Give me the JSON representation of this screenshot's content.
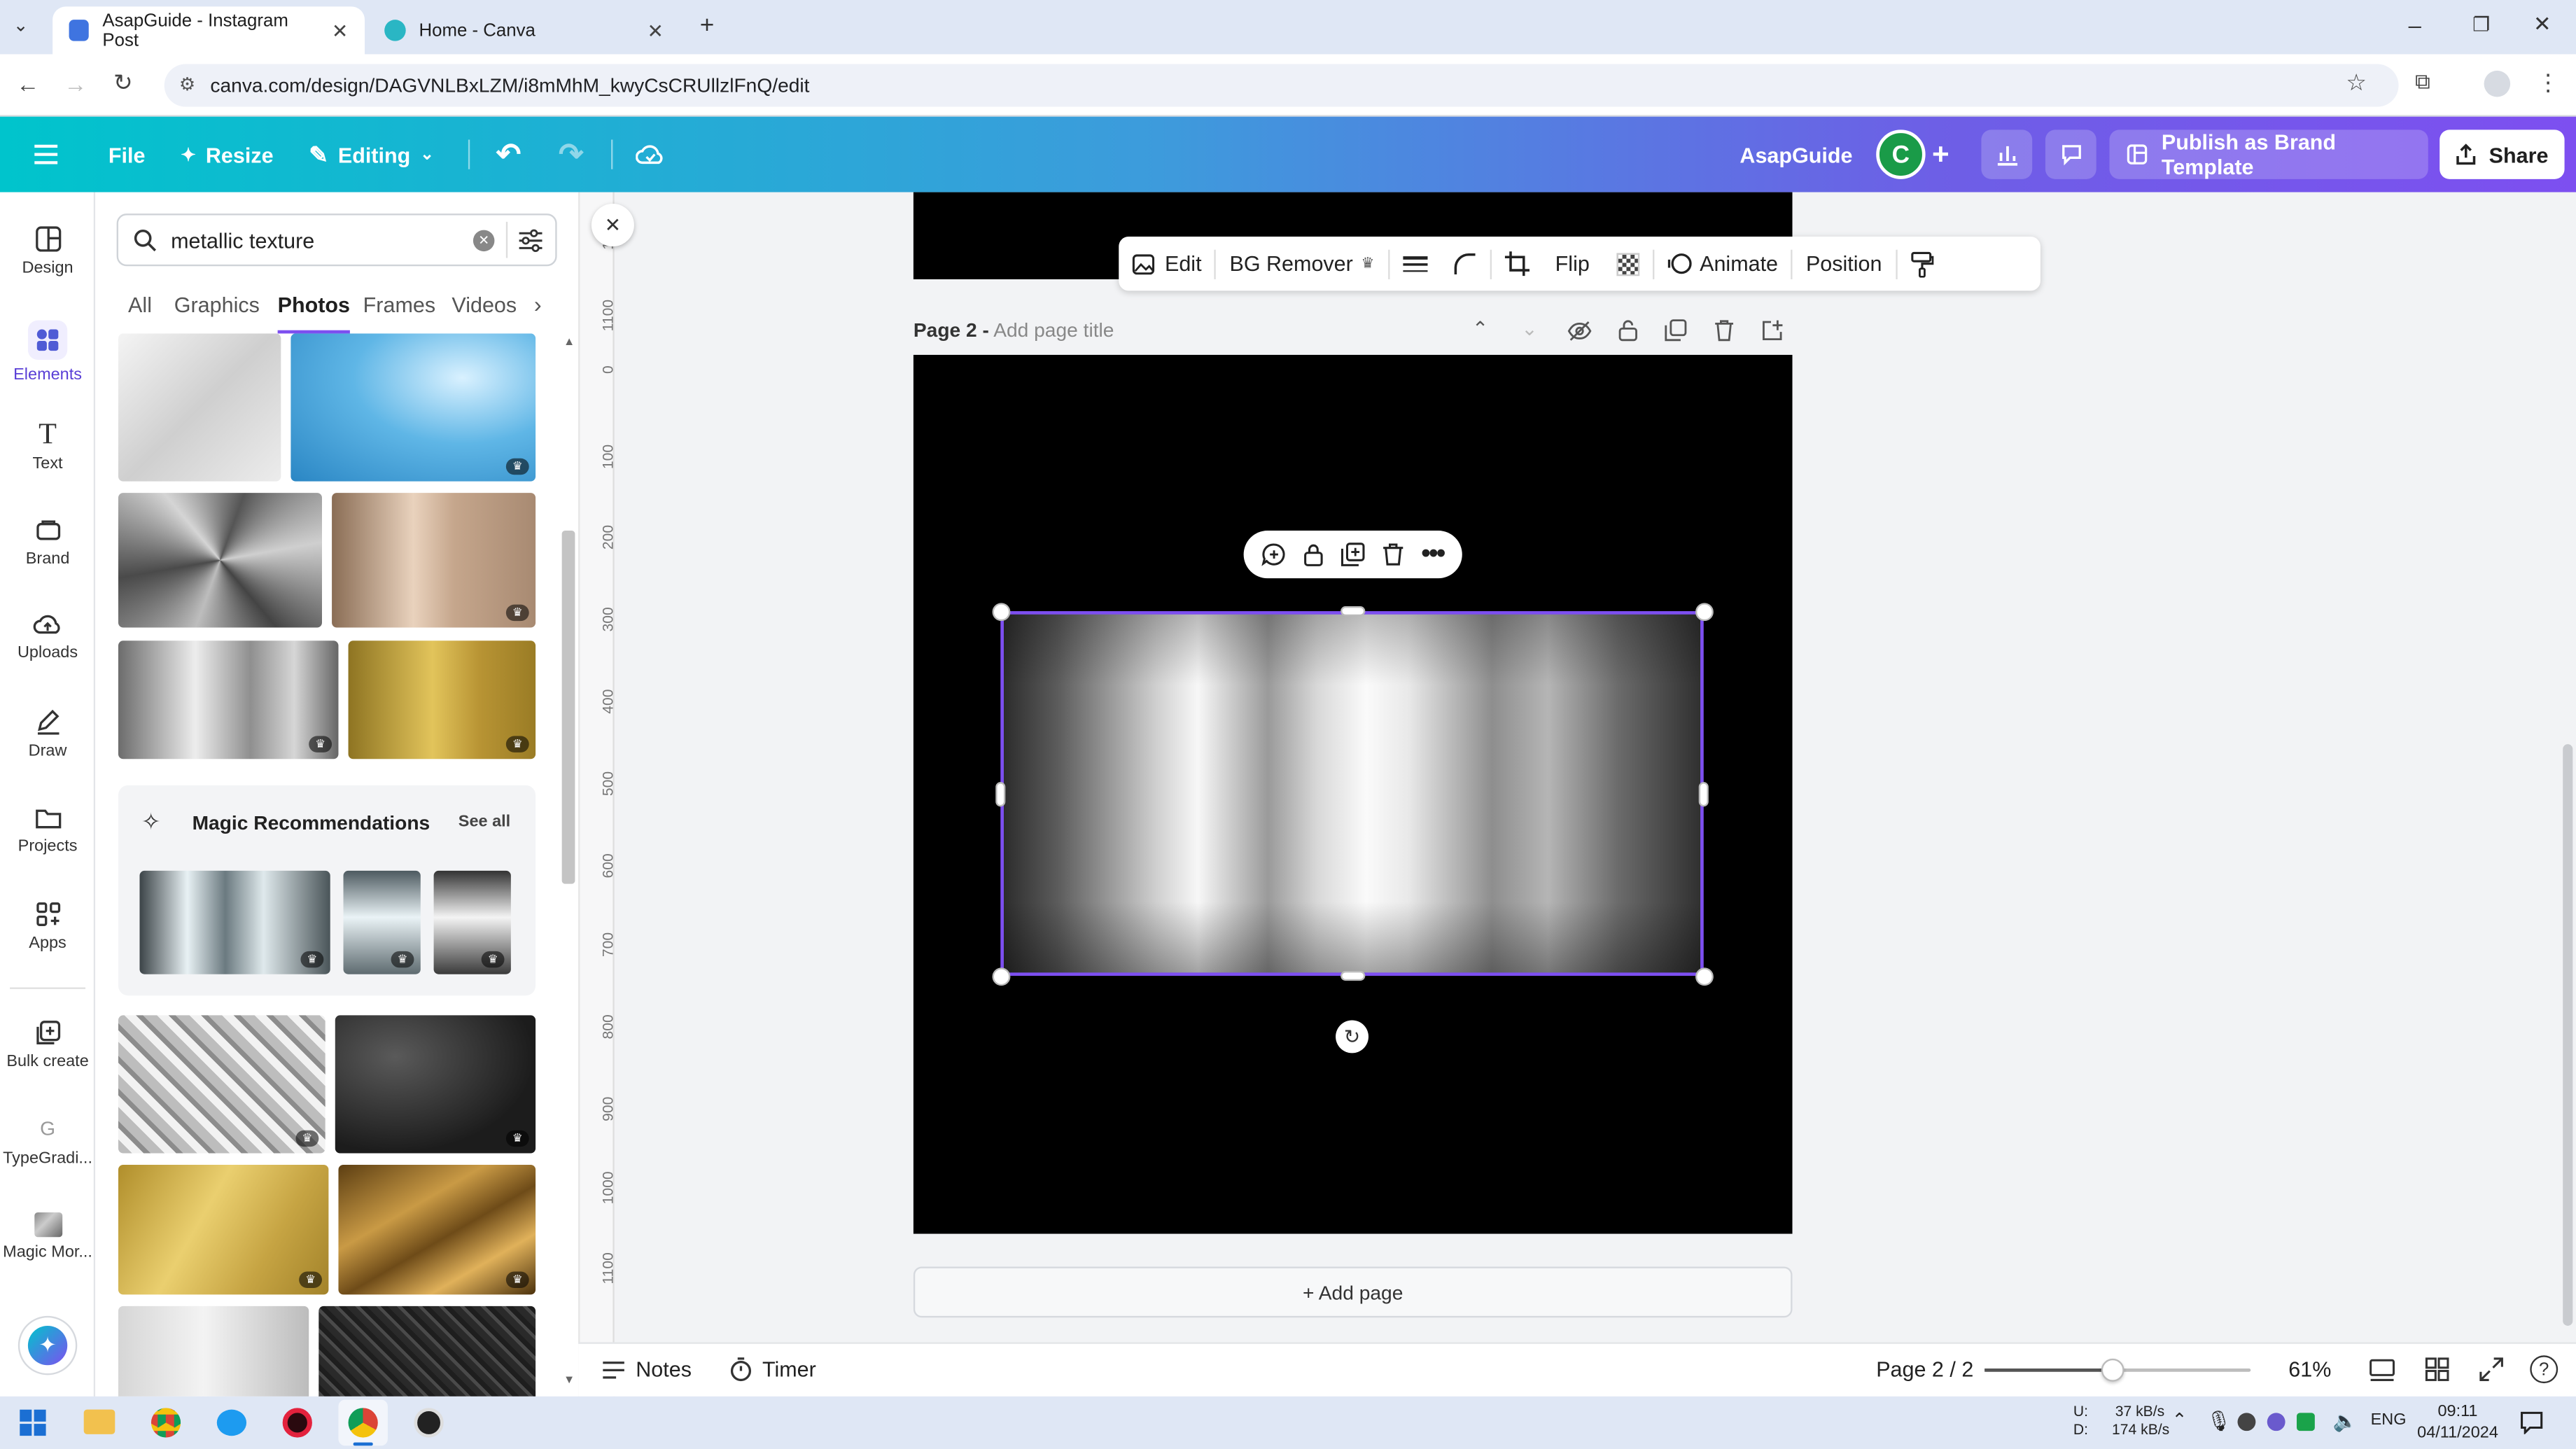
{
  "browser": {
    "tabs": [
      {
        "title": "AsapGuide - Instagram Post"
      },
      {
        "title": "Home - Canva"
      }
    ],
    "url": "canva.com/design/DAGVNLBxLZM/i8mMhM_kwyCsCRUllzlFnQ/edit"
  },
  "header": {
    "file": "File",
    "resize": "Resize",
    "mode": "Editing",
    "brand_name": "AsapGuide",
    "avatar_letter": "C",
    "publish": "Publish as Brand Template",
    "share": "Share"
  },
  "rail": [
    {
      "label": "Design",
      "icon": "design-icon"
    },
    {
      "label": "Elements",
      "icon": "elements-icon"
    },
    {
      "label": "Text",
      "icon": "text-icon"
    },
    {
      "label": "Brand",
      "icon": "brand-icon"
    },
    {
      "label": "Uploads",
      "icon": "uploads-icon"
    },
    {
      "label": "Draw",
      "icon": "draw-icon"
    },
    {
      "label": "Projects",
      "icon": "projects-icon"
    },
    {
      "label": "Apps",
      "icon": "apps-icon"
    },
    {
      "label": "Bulk create",
      "icon": "bulk-create-icon"
    },
    {
      "label": "TypeGradi...",
      "icon": "typegradient-icon"
    },
    {
      "label": "Magic Mor...",
      "icon": "magic-morph-icon"
    }
  ],
  "panel": {
    "search_value": "metallic texture",
    "tabs": [
      "All",
      "Graphics",
      "Photos",
      "Frames",
      "Videos"
    ],
    "active_tab": "Photos",
    "magic_title": "Magic Recommendations",
    "see_all": "See all"
  },
  "ruler": [
    "1000",
    "1100",
    "0",
    "100",
    "200",
    "300",
    "400",
    "500",
    "600",
    "700",
    "800",
    "900",
    "1000",
    "1100"
  ],
  "context_toolbar": {
    "edit": "Edit",
    "bg_remover": "BG Remover",
    "flip": "Flip",
    "animate": "Animate",
    "position": "Position"
  },
  "page": {
    "label": "Page 2 -",
    "title_placeholder": "Add page title"
  },
  "add_page": "+ Add page",
  "bottom": {
    "notes": "Notes",
    "timer": "Timer",
    "page_indicator": "Page 2 / 2",
    "zoom": "61%",
    "zoom_fraction": 0.48
  },
  "taskbar": {
    "net_up_label": "U:",
    "net_up": "37 kB/s",
    "net_down_label": "D:",
    "net_down": "174 kB/s",
    "lang": "ENG",
    "time": "09:11",
    "date": "04/11/2024"
  },
  "colors": {
    "accent": "#7d4ff0",
    "header_start": "#00c4cc",
    "header_end": "#7d4ff0",
    "avatar": "#1a9b48"
  }
}
